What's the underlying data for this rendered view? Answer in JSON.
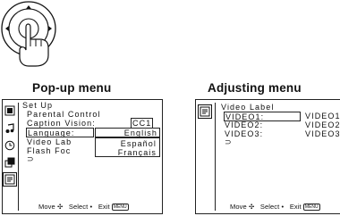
{
  "remote": {
    "joystick_icon": "remote-joystick-with-hand",
    "center_glyph": "⊕"
  },
  "left_panel": {
    "heading": "Pop-up menu",
    "menu": {
      "title": "Set Up",
      "items": [
        "Parental Control",
        "Caption Vision:",
        "Language:",
        "Video Lab",
        "Flash Foc"
      ],
      "caption_value": "CC1",
      "language_value": "English",
      "back_symbol": "⊃",
      "popup_options": [
        "Español",
        "Français"
      ]
    },
    "footer": {
      "move": "Move",
      "select": "Select",
      "exit": "Exit",
      "menu_key": "MENU"
    }
  },
  "right_panel": {
    "heading": "Adjusting menu",
    "menu": {
      "title": "Video Label",
      "items": [
        "VIDEO1:",
        "VIDEO2:",
        "VIDEO3:"
      ],
      "values": [
        "VIDEO1",
        "VIDEO2",
        "VIDEO3"
      ],
      "back_symbol": "⊃"
    },
    "footer": {
      "move": "Move",
      "select": "Select",
      "exit": "Exit",
      "menu_key": "MENU"
    }
  }
}
